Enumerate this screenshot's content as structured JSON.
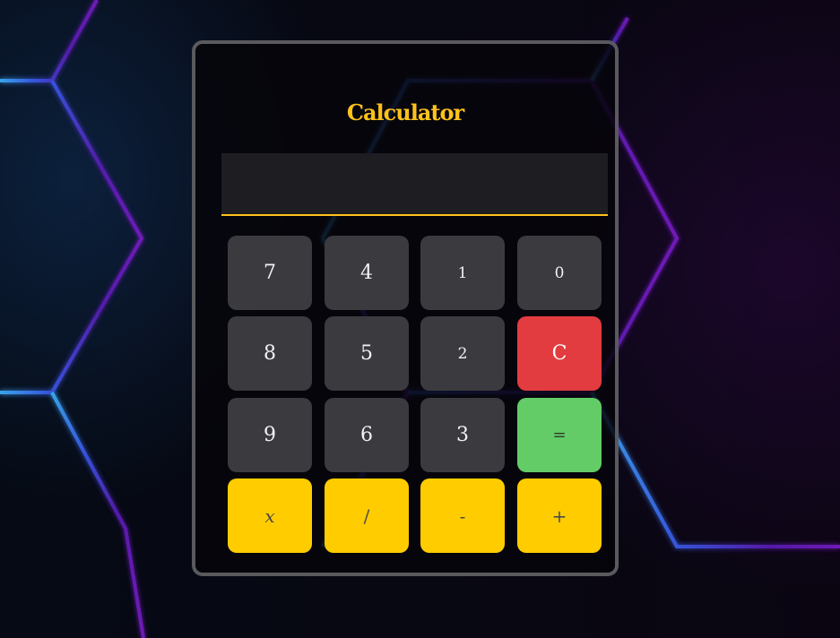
{
  "calculator": {
    "title": "Calculator",
    "display_value": "",
    "keys": {
      "k7": "7",
      "k4": "4",
      "k1": "1",
      "k0": "0",
      "k8": "8",
      "k5": "5",
      "k2": "2",
      "clear": "C",
      "k9": "9",
      "k6": "6",
      "k3": "3",
      "equals": "=",
      "multiply": "x",
      "divide": "/",
      "subtract": "-",
      "add": "+"
    }
  },
  "colors": {
    "accent": "#ffc21a",
    "clear_key": "#e23c40",
    "equals_key": "#64cc66",
    "operator_key": "#ffcc00",
    "number_key": "#3b3a3e",
    "card_border": "#5a5a5e",
    "background_hex_left": "#3a8cff",
    "background_hex_right": "#7a1fc8"
  }
}
